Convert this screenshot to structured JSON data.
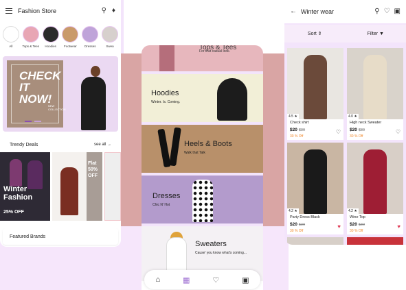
{
  "phone1": {
    "title": "Fashion Store",
    "icons": [
      "menu-icon",
      "search-icon",
      "bell-icon"
    ],
    "categories": [
      "All",
      "Tops & Tees",
      "Hoodies",
      "Footwear",
      "Dresses",
      "Swea"
    ],
    "banner": {
      "headline": "CHECK IT NOW!",
      "sub": "NEW COLLECTION"
    },
    "trending": {
      "title": "Trendy Deals",
      "action": "see all"
    },
    "deal1": {
      "line1": "Winter",
      "line2": "Fashion",
      "offer": "25% OFF"
    },
    "deal2": {
      "line1": "Flat",
      "line2": "50%",
      "line3": "OFF"
    },
    "featured": "Featured Brands"
  },
  "phone2": {
    "cards": [
      {
        "title": "Tops & Tees",
        "subtitle": "For that casual look."
      },
      {
        "title": "Hoodies",
        "subtitle": "Winter. Is. Coming."
      },
      {
        "title": "Heels & Boots",
        "subtitle": "Walk that Talk"
      },
      {
        "title": "Dresses",
        "subtitle": "Chic N' Hot"
      },
      {
        "title": "Sweaters",
        "subtitle": "Cause' you know what's coming..."
      }
    ],
    "nav": [
      "home-icon",
      "categories-icon",
      "wishlist-icon",
      "bag-icon"
    ]
  },
  "phone3": {
    "title": "Winter wear",
    "sort": "Sort",
    "filter": "Filter",
    "products": [
      {
        "name": "Check shirt",
        "price": "$20",
        "old": "$30",
        "off": "30 % Off",
        "rating": "4.5",
        "liked": false
      },
      {
        "name": "High neck Sweater",
        "price": "$20",
        "old": "$30",
        "off": "30 % Off",
        "rating": "4.0",
        "liked": false
      },
      {
        "name": "Party Dress Black",
        "price": "$20",
        "old": "$30",
        "off": "30 % Off",
        "rating": "4.2",
        "liked": true
      },
      {
        "name": "Wine Top",
        "price": "$20",
        "old": "$30",
        "off": "30 % Off",
        "rating": "4.2",
        "liked": true
      }
    ]
  },
  "colors": {
    "accent": "#9b6bd1",
    "lilac": "#f3e4fb",
    "mauve": "#d9a5a4",
    "sale": "#f28a2e",
    "heart": "#e0435d"
  }
}
